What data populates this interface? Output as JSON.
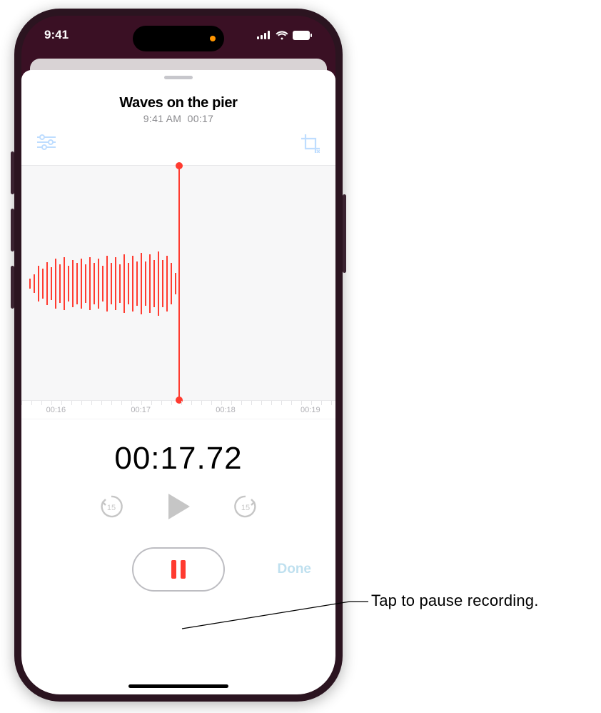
{
  "status": {
    "time": "9:41"
  },
  "recording": {
    "title": "Waves on the pier",
    "subtitle_time": "9:41 AM",
    "subtitle_duration": "00:17",
    "elapsed": "00:17.72"
  },
  "timeline": {
    "ticks": [
      "00:16",
      "00:17",
      "00:18",
      "00:19"
    ]
  },
  "controls": {
    "done_label": "Done",
    "skip_back_seconds": "15",
    "skip_fwd_seconds": "15"
  },
  "callout": {
    "text": "Tap to pause recording."
  },
  "icons": {
    "sliders": "sliders-icon",
    "crop": "crop-icon",
    "play": "play-icon",
    "pause": "pause-icon",
    "skip_back": "skip-back-15-icon",
    "skip_forward": "skip-forward-15-icon"
  }
}
